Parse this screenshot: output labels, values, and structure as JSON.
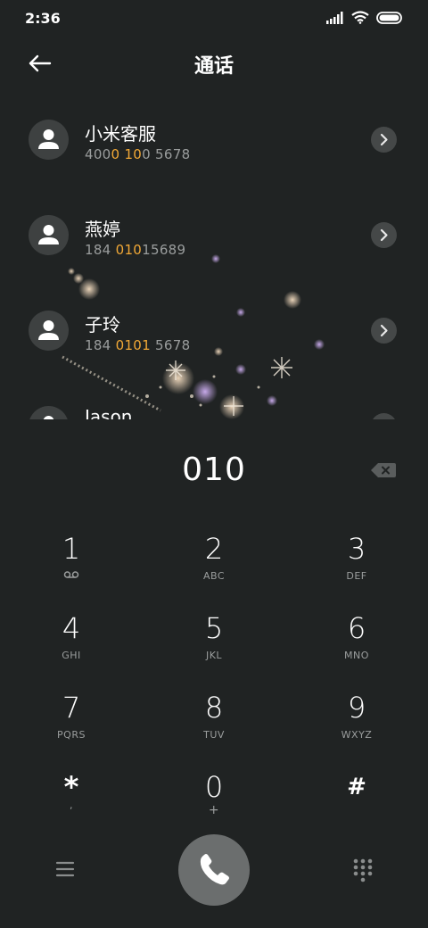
{
  "status_bar": {
    "time": "2:36"
  },
  "header": {
    "title": "通话"
  },
  "contacts": [
    {
      "name": "小米客服",
      "number_parts": [
        {
          "text": "400",
          "hl": false
        },
        {
          "text": "0",
          "hl": true
        },
        {
          "text": " ",
          "hl": false
        },
        {
          "text": "10",
          "hl": true
        },
        {
          "text": "0 5678",
          "hl": false
        }
      ]
    },
    {
      "name": "燕婷",
      "number_parts": [
        {
          "text": "184 ",
          "hl": false
        },
        {
          "text": "010",
          "hl": true
        },
        {
          "text": "15689",
          "hl": false
        }
      ]
    },
    {
      "name": "子玲",
      "number_parts": [
        {
          "text": "184 ",
          "hl": false
        },
        {
          "text": "0101",
          "hl": true
        },
        {
          "text": " 5678",
          "hl": false
        }
      ]
    },
    {
      "name": "Jason",
      "number_parts": []
    }
  ],
  "dialer": {
    "input": "010"
  },
  "keypad": [
    {
      "digit": "1",
      "letters": ""
    },
    {
      "digit": "2",
      "letters": "ABC"
    },
    {
      "digit": "3",
      "letters": "DEF"
    },
    {
      "digit": "4",
      "letters": "GHI"
    },
    {
      "digit": "5",
      "letters": "JKL"
    },
    {
      "digit": "6",
      "letters": "MNO"
    },
    {
      "digit": "7",
      "letters": "PQRS"
    },
    {
      "digit": "8",
      "letters": "TUV"
    },
    {
      "digit": "9",
      "letters": "WXYZ"
    },
    {
      "digit": "*",
      "letters": ","
    },
    {
      "digit": "0",
      "letters": "+"
    },
    {
      "digit": "#",
      "letters": ""
    }
  ],
  "colors": {
    "background": "#202323",
    "highlight": "#f1a836",
    "secondary_text": "#9a9d9d",
    "call_button": "#6b6e6e"
  },
  "icons": {
    "back": "arrow-left-icon",
    "backspace": "backspace-icon",
    "call": "phone-icon",
    "menu": "menu-icon",
    "keypad_toggle": "dialpad-icon",
    "detail": "chevron-right-icon",
    "voicemail": "voicemail-icon"
  }
}
